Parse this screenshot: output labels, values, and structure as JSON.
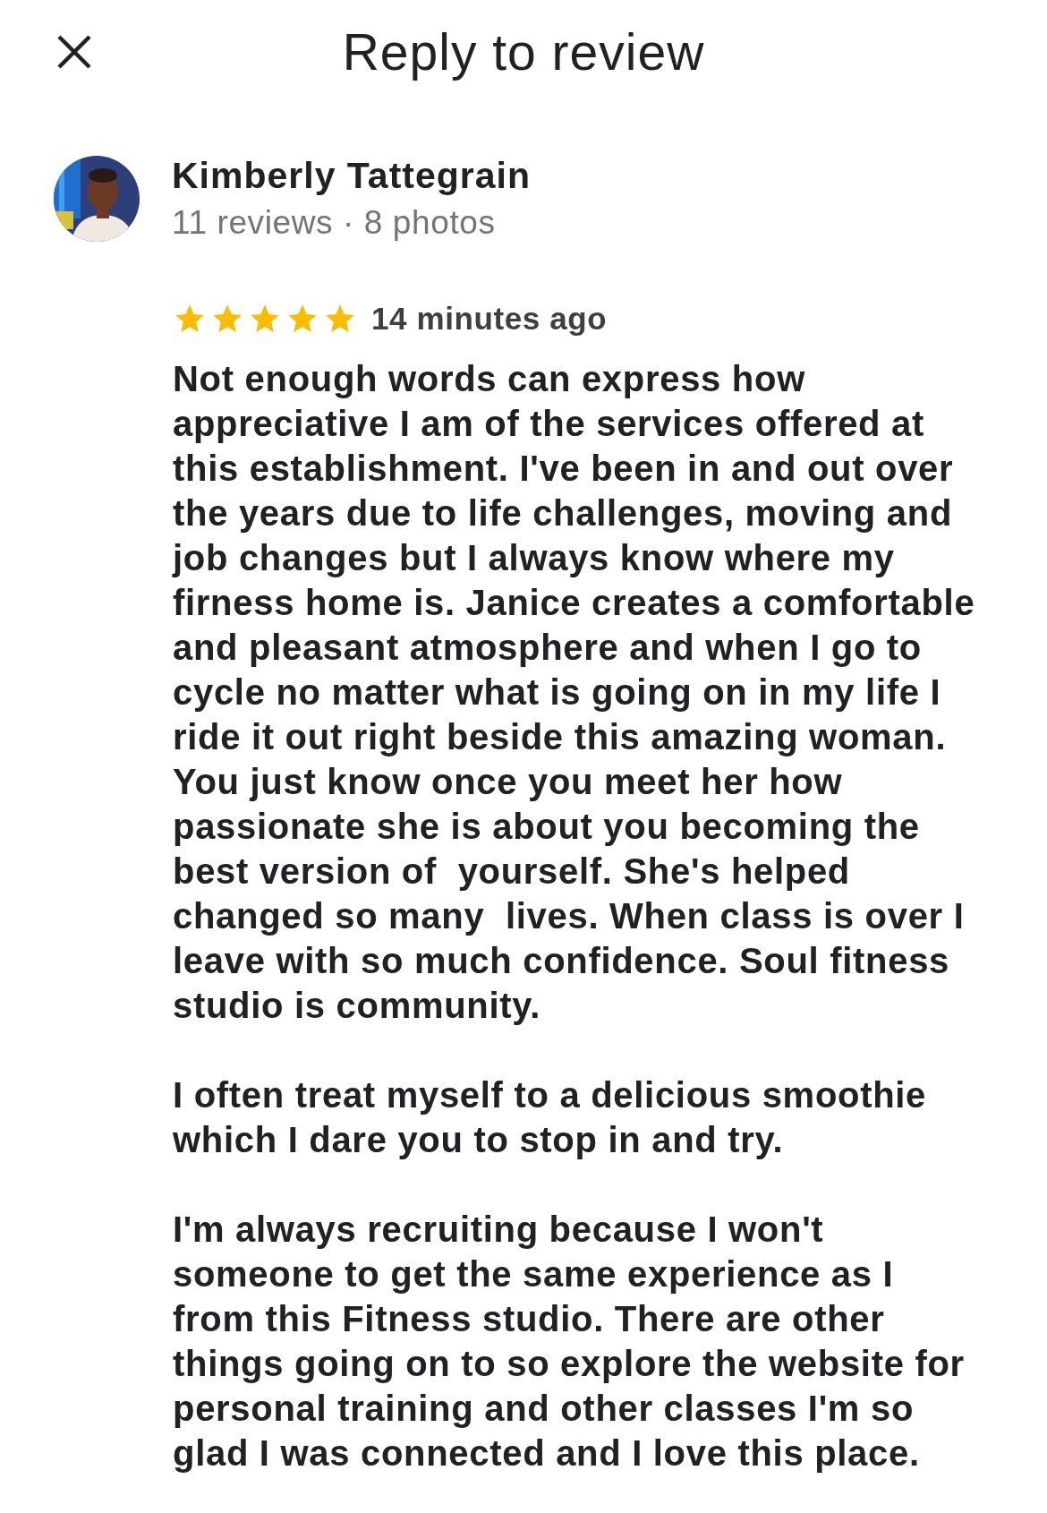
{
  "header": {
    "title": "Reply to review"
  },
  "reviewer": {
    "name": "Kimberly Tattegrain",
    "meta": "11 reviews · 8 photos"
  },
  "review": {
    "stars": 5,
    "time": "14 minutes ago",
    "paragraphs": [
      [
        "Not enough words can express how",
        "appreciative I am of the services offered at",
        "this establishment. I've been in and out over",
        "the years due to life challenges, moving and",
        "job changes but I always know where my",
        "firness home is. Janice creates a comfortable",
        "and pleasant atmosphere and when I go to",
        "cycle no matter what is going on in my life I",
        "ride it out right beside this amazing woman.",
        "You just know once you meet her how",
        "passionate she is about you becoming the",
        "best version of  yourself. She's helped",
        "changed so many  lives. When class is over I",
        "leave with so much confidence. Soul fitness",
        "studio is community."
      ],
      [
        "I often treat myself to a delicious smoothie",
        "which I dare you to stop in and try."
      ],
      [
        "I'm always recruiting because I won't",
        "someone to get the same experience as I",
        "from this Fitness studio. There are other",
        "things going on to so explore the website for",
        "personal training and other classes I'm so",
        "glad I was connected and I love this place."
      ]
    ]
  }
}
